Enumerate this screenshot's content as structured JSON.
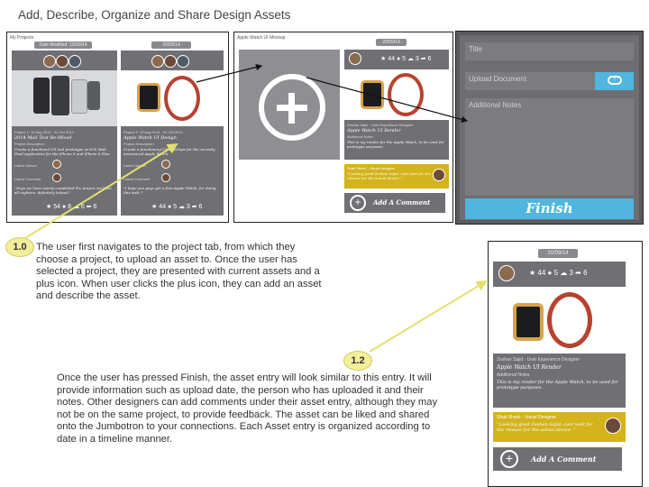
{
  "page_title": "Add, Describe, Organize and Share Design Assets",
  "panel1": {
    "label": "My Projects",
    "left_card": {
      "date": "Date Modified: 10/19/14",
      "project_line": "Project 1: 15 Aug 2014 - 31 Oct 2014",
      "project_name": "2014 Mail Text Re-Mixed",
      "desc_label": "Project Description",
      "desc_text": "Create a functional UX and prototype an IOS Mail Feed application for the iPhone 6 and iPhone 6 Plus.",
      "latest_upload": "Latest Upload",
      "latest_comment": "Latest Comment",
      "comment_text": "\"Guys we have nearly completed the project we have all nighters, definitely helped.\"",
      "stats": "★ 54 ● 8 ☁ 6 ➦ 6"
    },
    "right_card": {
      "date": "20/09/14",
      "project_line": "Project 2: 10 Aug 2014 - 31 Oct 2014",
      "project_name": "Apple Watch UI Design",
      "desc_label": "Project Description",
      "desc_text": "Create a functioning UX Mockups for the recently announced Apple Watch.",
      "latest_upload": "Latest Upload",
      "latest_comment": "Latest Comment",
      "comment_text": "\"I hope you guys get a free Apple Watch, for doing this task !\"",
      "stats": "★ 44 ● 5 ☁ 3 ➦ 6"
    }
  },
  "panel2": {
    "label": "Apple Watch UI Mockup",
    "date": "20/09/14",
    "stats": "★ 44 ● 5 ☁ 3 ➦ 6",
    "author": "Zeshan Sajid · User Experience Designer",
    "asset_name": "Apple Watch UI Render",
    "notes_label": "Additional Notes",
    "notes_text": "This is my render for the Apple Watch, to be used for prototype purposes.",
    "comment_author": "Shak Shack · Visual Designer",
    "comment_text": "\"Looking good Zeshan Sajid, cant wait for the release for the actual device .\"",
    "add_comment": "Add A Comment"
  },
  "panel3": {
    "title_placeholder": "Title",
    "upload_placeholder": "Upload Document",
    "notes_placeholder": "Additional Notes",
    "finish_label": "Finish"
  },
  "panel4": {
    "date": "20/09/14",
    "stats": "★ 44 ● 5 ☁ 3 ➦ 6",
    "author": "Zeshan Sajid · User Experience Designer",
    "asset_name": "Apple Watch UI Render",
    "notes_label": "Additional Notes",
    "notes_text": "This is my render for the Apple Watch, to be used for prototype purposes.",
    "comment_author": "Shak Shack · Visual Designer",
    "comment_text": "\"Looking good Zeshan Sajid, cant wait for the release for the actual device .\"",
    "add_comment": "Add A Comment"
  },
  "step1": {
    "badge": "1.0",
    "text": "The user first navigates to the project tab, from which they choose a project, to upload an asset to. Once the user has selected a project, they are presented with current assets and a plus icon. When user clicks the plus icon, they can add an asset and describe the asset."
  },
  "step2": {
    "badge": "1.2",
    "text": "Once the user has pressed Finish, the asset entry will look similar to this entry. It will provide information such as upload date, the person who has uploaded it and their notes. Other designers can add comments under their asset entry, although they may not be on the same project, to provide feedback. The asset can be liked and shared onto the Jumbotron to your connections. Each Asset entry is organized according to date in a timeline manner."
  },
  "colors": {
    "card": "#6f6f74",
    "accent_blue": "#4fb6e0",
    "comment_yellow": "#d4b31b",
    "badge_fill": "#f2ef9a",
    "arrow_yellow": "#e3e06a"
  }
}
